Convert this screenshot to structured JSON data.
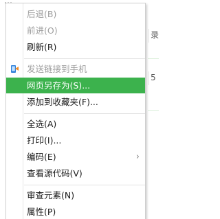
{
  "background": {
    "top_fragment": "…",
    "edge_chars": [
      "录",
      "5"
    ]
  },
  "context_menu": {
    "items": [
      {
        "label": "后退(B)",
        "state": "disabled"
      },
      {
        "label": "前进(O)",
        "state": "disabled"
      },
      {
        "label": "刷新(R)",
        "state": "enabled"
      },
      {
        "label": "发送链接到手机",
        "state": "disabled",
        "icon": "send-to-phone-icon"
      },
      {
        "label": "网页另存为(S)...",
        "state": "highlighted"
      },
      {
        "label": "添加到收藏夹(F)...",
        "state": "enabled"
      },
      {
        "label": "全选(A)",
        "state": "enabled"
      },
      {
        "label": "打印(I)...",
        "state": "enabled"
      },
      {
        "label": "编码(E)",
        "state": "enabled",
        "submenu_arrow": "›"
      },
      {
        "label": "查看源代码(V)",
        "state": "enabled"
      },
      {
        "label": "审查元素(N)",
        "state": "enabled"
      },
      {
        "label": "属性(P)",
        "state": "enabled"
      }
    ]
  },
  "colors": {
    "highlight": "#3cb24d",
    "text": "#1a1a1a",
    "disabled_text": "#9e9e9e",
    "icon_blue": "#2f7fd8",
    "icon_orange": "#f08a24"
  }
}
